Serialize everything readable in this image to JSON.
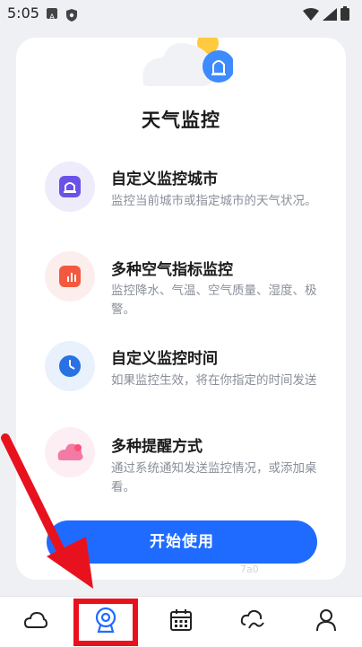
{
  "status_bar": {
    "time": "5:05"
  },
  "card": {
    "title": "天气监控",
    "features": [
      {
        "title": "自定义监控城市",
        "desc": "监控当前城市或指定城市的天气状况。",
        "icon": "city-alarm-icon"
      },
      {
        "title": "多种空气指标监控",
        "desc": "监控降水、气温、空气质量、湿度、极警。",
        "icon": "bar-chart-icon"
      },
      {
        "title": "自定义监控时间",
        "desc": "如果监控生效，将在你指定的时间发送",
        "icon": "clock-icon"
      },
      {
        "title": "多种提醒方式",
        "desc": "通过系统通知发送监控情况，或添加桌看。",
        "icon": "notification-cloud-icon"
      }
    ],
    "start_label": "开始使用"
  },
  "nav": [
    "weather-cloud-icon",
    "monitor-camera-icon",
    "calendar-icon",
    "cloud-link-icon",
    "profile-icon"
  ],
  "colors": {
    "accent": "#1f6bff",
    "annotation": "#e8121e"
  },
  "watermark": "7a0"
}
